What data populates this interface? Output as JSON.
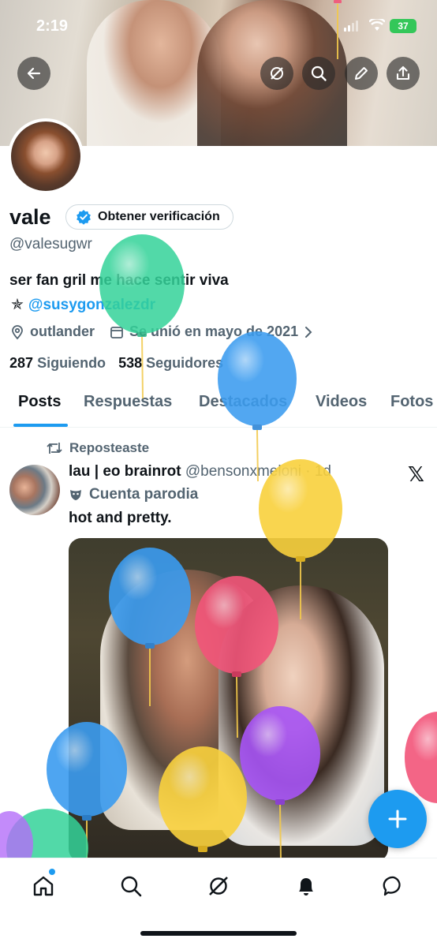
{
  "status_bar": {
    "time": "2:19",
    "battery": "37"
  },
  "header_buttons": [
    "back-icon",
    "grok-icon",
    "search-icon",
    "edit-icon",
    "share-icon"
  ],
  "profile": {
    "name": "vale",
    "verify_label": "Obtener verificación",
    "handle": "@valesugwr",
    "bio_line1": "ser fan gril me hace sentir viva",
    "bio_star": "✯",
    "bio_link": "@susygonzalezdr",
    "location": "outlander",
    "joined": "Se unió en mayo de 2021",
    "following_count": "287",
    "following_label": "Siguiendo",
    "followers_count": "538",
    "followers_label": "Seguidores"
  },
  "tabs": [
    "Posts",
    "Respuestas",
    "Destacados",
    "Videos",
    "Fotos"
  ],
  "post": {
    "repost_label": "Reposteaste",
    "author_name": "lau | eo brainrot",
    "author_handle": "@bensonxmeloni",
    "time": "· 1d",
    "parody_label": "Cuenta parodia",
    "text": "hot and pretty."
  },
  "colors": {
    "accent": "#1d9bf0",
    "text": "#0f1419",
    "muted": "#536471"
  },
  "nav": [
    "home-icon",
    "search-icon",
    "grok-icon",
    "notifications-icon",
    "messages-icon"
  ]
}
